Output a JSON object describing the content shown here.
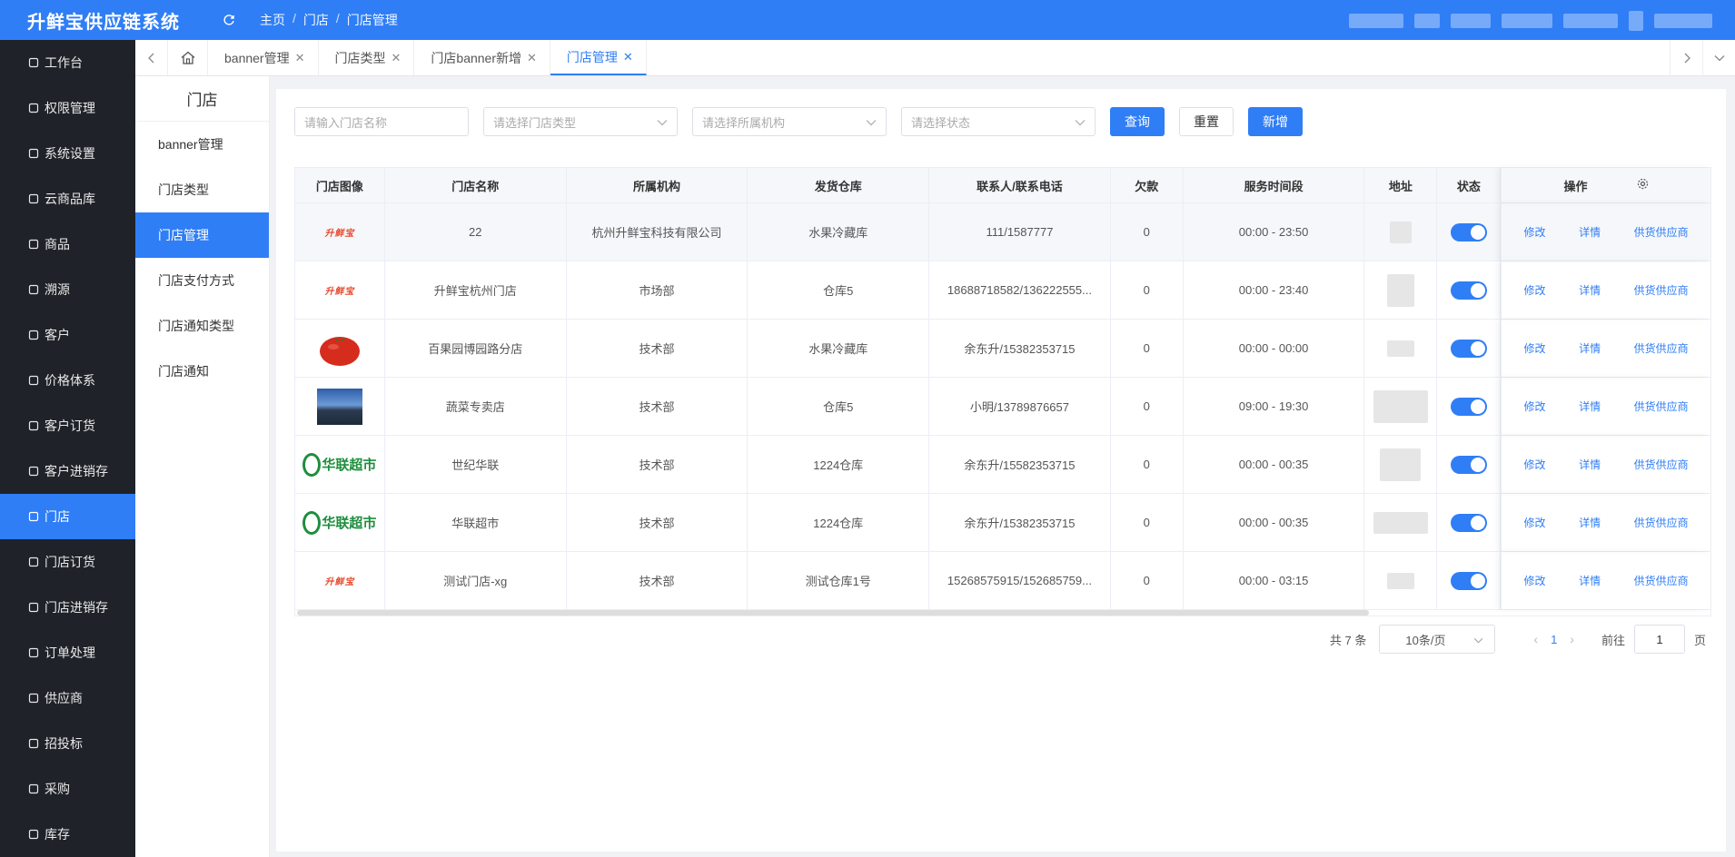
{
  "app": {
    "title": "升鲜宝供应链系统"
  },
  "breadcrumb": [
    "主页",
    "门店",
    "门店管理"
  ],
  "sidenav": [
    {
      "label": "工作台",
      "icon": "monitor-icon"
    },
    {
      "label": "权限管理",
      "icon": "shield-icon"
    },
    {
      "label": "系统设置",
      "icon": "gear-icon"
    },
    {
      "label": "云商品库",
      "icon": "cloud-icon"
    },
    {
      "label": "商品",
      "icon": "goods-icon"
    },
    {
      "label": "溯源",
      "icon": "trace-icon"
    },
    {
      "label": "客户",
      "icon": "customer-icon"
    },
    {
      "label": "价格体系",
      "icon": "price-icon"
    },
    {
      "label": "客户订货",
      "icon": "order-icon"
    },
    {
      "label": "客户进销存",
      "icon": "bank-icon"
    },
    {
      "label": "门店",
      "icon": "store-icon"
    },
    {
      "label": "门店订货",
      "icon": "store-order-icon"
    },
    {
      "label": "门店进销存",
      "icon": "inventory-icon"
    },
    {
      "label": "订单处理",
      "icon": "send-icon"
    },
    {
      "label": "供应商",
      "icon": "supplier-icon"
    },
    {
      "label": "招投标",
      "icon": "bid-icon"
    },
    {
      "label": "采购",
      "icon": "purchase-icon"
    },
    {
      "label": "库存",
      "icon": "stock-icon"
    }
  ],
  "tabs": [
    {
      "label": "banner管理"
    },
    {
      "label": "门店类型"
    },
    {
      "label": "门店banner新增"
    },
    {
      "label": "门店管理"
    }
  ],
  "subnav": {
    "title": "门店",
    "items": [
      "banner管理",
      "门店类型",
      "门店管理",
      "门店支付方式",
      "门店通知类型",
      "门店通知"
    ]
  },
  "filters": {
    "name_placeholder": "请输入门店名称",
    "type_placeholder": "请选择门店类型",
    "org_placeholder": "请选择所属机构",
    "status_placeholder": "请选择状态",
    "query": "查询",
    "reset": "重置",
    "add": "新增"
  },
  "table": {
    "headers": {
      "img": "门店图像",
      "name": "门店名称",
      "org": "所属机构",
      "warehouse": "发货仓库",
      "contact": "联系人/联系电话",
      "debt": "欠款",
      "time": "服务时间段",
      "addr": "地址",
      "status": "状态",
      "ops": "操作"
    },
    "op_labels": {
      "edit": "修改",
      "detail": "详情",
      "supplier": "供货供应商"
    },
    "logo_text": "升鲜宝",
    "hualian_text": "华联超市",
    "rows": [
      {
        "name": "22",
        "org": "杭州升鲜宝科技有限公司",
        "warehouse": "水果冷藏库",
        "contact": "111/1587777",
        "debt": "0",
        "time": "00:00 - 23:50"
      },
      {
        "name": "升鲜宝杭州门店",
        "org": "市场部",
        "warehouse": "仓库5",
        "contact": "18688718582/136222555...",
        "debt": "0",
        "time": "00:00 - 23:40"
      },
      {
        "name": "百果园博园路分店",
        "org": "技术部",
        "warehouse": "水果冷藏库",
        "contact": "余东升/15382353715",
        "debt": "0",
        "time": "00:00 - 00:00"
      },
      {
        "name": "蔬菜专卖店",
        "org": "技术部",
        "warehouse": "仓库5",
        "contact": "小明/13789876657",
        "debt": "0",
        "time": "09:00 - 19:30"
      },
      {
        "name": "世纪华联",
        "org": "技术部",
        "warehouse": "1224仓库",
        "contact": "余东升/15582353715",
        "debt": "0",
        "time": "00:00 - 00:35"
      },
      {
        "name": "华联超市",
        "org": "技术部",
        "warehouse": "1224仓库",
        "contact": "余东升/15382353715",
        "debt": "0",
        "time": "00:00 - 00:35"
      },
      {
        "name": "测试门店-xg",
        "org": "技术部",
        "warehouse": "测试仓库1号",
        "contact": "15268575915/152685759...",
        "debt": "0",
        "time": "00:00 - 03:15"
      }
    ]
  },
  "pagination": {
    "total": "共 7 条",
    "page_size": "10条/页",
    "current": "1",
    "goto_label": "前往",
    "goto_value": "1",
    "page_suffix": "页"
  },
  "colors": {
    "primary": "#2f7ef6",
    "sidebar": "#1f2329"
  }
}
